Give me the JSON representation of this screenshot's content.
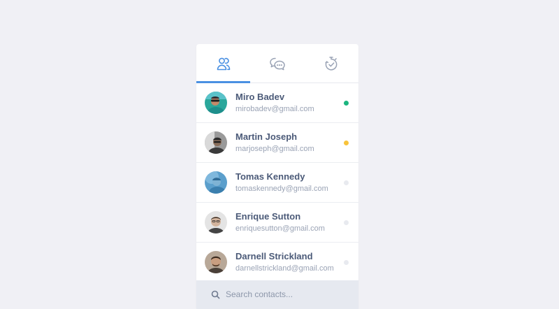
{
  "tabs": [
    {
      "icon": "contacts-icon",
      "active": true
    },
    {
      "icon": "chat-bubbles-icon",
      "active": false
    },
    {
      "icon": "timer-icon",
      "active": false
    }
  ],
  "contacts": [
    {
      "name": "Miro Badev",
      "email": "mirobadev@gmail.com",
      "status": "online",
      "status_color": "#1cb57f"
    },
    {
      "name": "Martin Joseph",
      "email": "marjoseph@gmail.com",
      "status": "away",
      "status_color": "#f8c33b"
    },
    {
      "name": "Tomas Kennedy",
      "email": "tomaskennedy@gmail.com",
      "status": "offline",
      "status_color": "#e8eaef"
    },
    {
      "name": "Enrique Sutton",
      "email": "enriquesutton@gmail.com",
      "status": "offline",
      "status_color": "#e8eaef"
    },
    {
      "name": "Darnell Strickland",
      "email": "darnellstrickland@gmail.com",
      "status": "offline",
      "status_color": "#e8eaef"
    }
  ],
  "search": {
    "placeholder": "Search contacts..."
  },
  "colors": {
    "background": "#f0f0f5",
    "accent": "#4a90e2",
    "name_text": "#4b5a78",
    "email_text": "#9aa3b5"
  }
}
